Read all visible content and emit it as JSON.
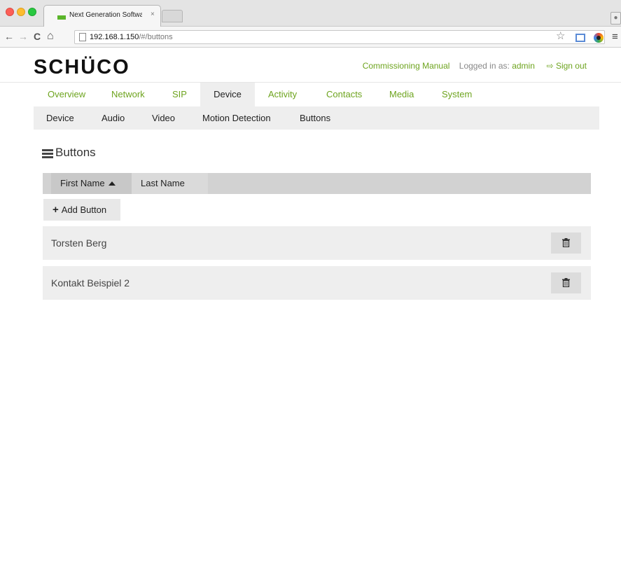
{
  "browser": {
    "tab_title": "Next Generation Software",
    "tab_close": "×",
    "url_host": "192.168.1.150",
    "url_path": "/#/buttons",
    "back_glyph": "←",
    "forward_glyph": "→",
    "reload_glyph": "C",
    "home_glyph": "⌂",
    "star_glyph": "☆",
    "menu_glyph": "≡"
  },
  "header": {
    "logo": "SCHÜCO",
    "manual_link": "Commissioning Manual",
    "logged_in_label": "Logged in as:",
    "user": "admin",
    "signout_glyph": "⇨",
    "signout": "Sign out",
    "accent_color": "#6ea41f"
  },
  "main_nav": [
    {
      "label": "Overview"
    },
    {
      "label": "Network"
    },
    {
      "label": "SIP"
    },
    {
      "label": "Device"
    },
    {
      "label": "Activity"
    },
    {
      "label": "Contacts"
    },
    {
      "label": "Media"
    },
    {
      "label": "System"
    }
  ],
  "sub_nav": [
    {
      "label": "Device"
    },
    {
      "label": "Audio"
    },
    {
      "label": "Video"
    },
    {
      "label": "Motion Detection"
    },
    {
      "label": "Buttons"
    }
  ],
  "section": {
    "title": "Buttons"
  },
  "sort": {
    "first_name": "First Name",
    "last_name": "Last Name"
  },
  "add_button": {
    "plus": "+",
    "label": "Add Button"
  },
  "rows": [
    {
      "name": "Torsten Berg"
    },
    {
      "name": "Kontakt Beispiel 2"
    }
  ],
  "icons": {
    "menu": "menu-icon",
    "trash": "trash-icon",
    "sort_asc": "sort-ascending-icon"
  }
}
